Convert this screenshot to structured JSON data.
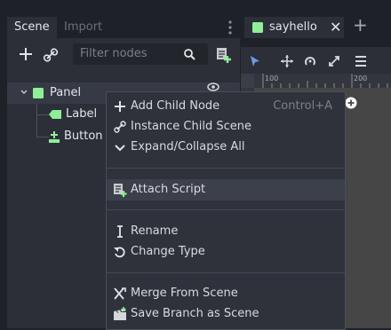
{
  "dock": {
    "tabs": [
      "Scene",
      "Import"
    ],
    "filter_placeholder": "Filter nodes"
  },
  "tree": [
    {
      "label": "Panel",
      "icon": "panel-node-icon",
      "color": "#8eef97"
    },
    {
      "label": "Label",
      "icon": "label-node-icon",
      "color": "#8eef97"
    },
    {
      "label": "Button",
      "icon": "button-node-icon",
      "color": "#8eef97"
    }
  ],
  "editor": {
    "scene_tab": "sayhello",
    "close_glyph": "✕",
    "new_tab_glyph": "+",
    "ruler_ticks": [
      "100",
      "200"
    ]
  },
  "context_menu": {
    "items": [
      {
        "label": "Add Child Node",
        "shortcut": "Control+A",
        "icon": "plus-icon"
      },
      {
        "label": "Instance Child Scene",
        "icon": "link-icon"
      },
      {
        "label": "Expand/Collapse All",
        "icon": "chevron-down-icon"
      },
      {
        "label": "Attach Script",
        "icon": "script-add-icon",
        "highlighted": true
      },
      {
        "label": "Rename",
        "icon": "text-cursor-icon"
      },
      {
        "label": "Change Type",
        "icon": "rotate-icon"
      },
      {
        "label": "Merge From Scene",
        "icon": "merge-icon"
      },
      {
        "label": "Save Branch as Scene",
        "icon": "clapperboard-icon"
      }
    ]
  },
  "colors": {
    "accent_green": "#8eef97",
    "highlight": "#3c404b",
    "selection_blue": "#699ce8"
  }
}
